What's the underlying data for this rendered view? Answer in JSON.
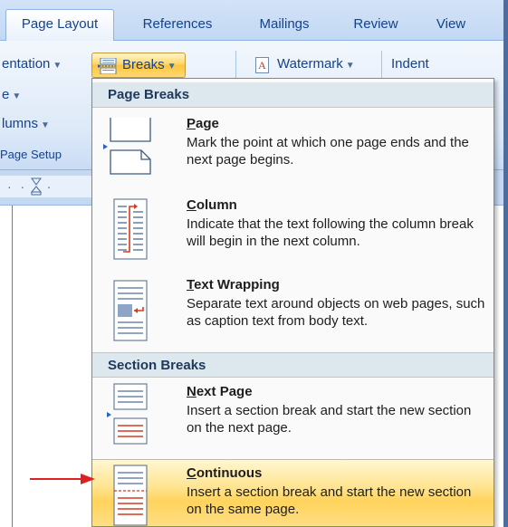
{
  "ribbon_tabs": {
    "page_layout": "Page Layout",
    "references": "References",
    "mailings": "Mailings",
    "review": "Review",
    "view": "View"
  },
  "ribbon": {
    "orientation": "entation",
    "size": "e",
    "columns": "lumns",
    "breaks": "Breaks",
    "watermark": "Watermark",
    "indent": "Indent",
    "group_label": "Page Setup"
  },
  "menu": {
    "page_breaks_header": "Page Breaks",
    "section_breaks_header": "Section Breaks",
    "items": [
      {
        "title_first": "P",
        "title_rest": "age",
        "desc": "Mark the point at which one page ends and the next page begins."
      },
      {
        "title_first": "C",
        "title_rest": "olumn",
        "desc": "Indicate that the text following the column break will begin in the next column."
      },
      {
        "title_first": "T",
        "title_rest": "ext Wrapping",
        "desc": "Separate text around objects on web pages, such as caption text from body text."
      },
      {
        "title_first": "N",
        "title_rest": "ext Page",
        "desc": "Insert a section break and start the new section on the next page."
      },
      {
        "title_first": "C",
        "title_rest": "ontinuous",
        "desc": "Insert a section break and start the new section on the same page."
      }
    ]
  },
  "colors": {
    "ribbon_text": "#15428b",
    "highlight": "#ffd35c",
    "arrow": "#e02020"
  },
  "icons": {
    "breaks": "page-breaks-icon",
    "watermark": "watermark-icon",
    "dropdown": "chevron-down-icon"
  }
}
